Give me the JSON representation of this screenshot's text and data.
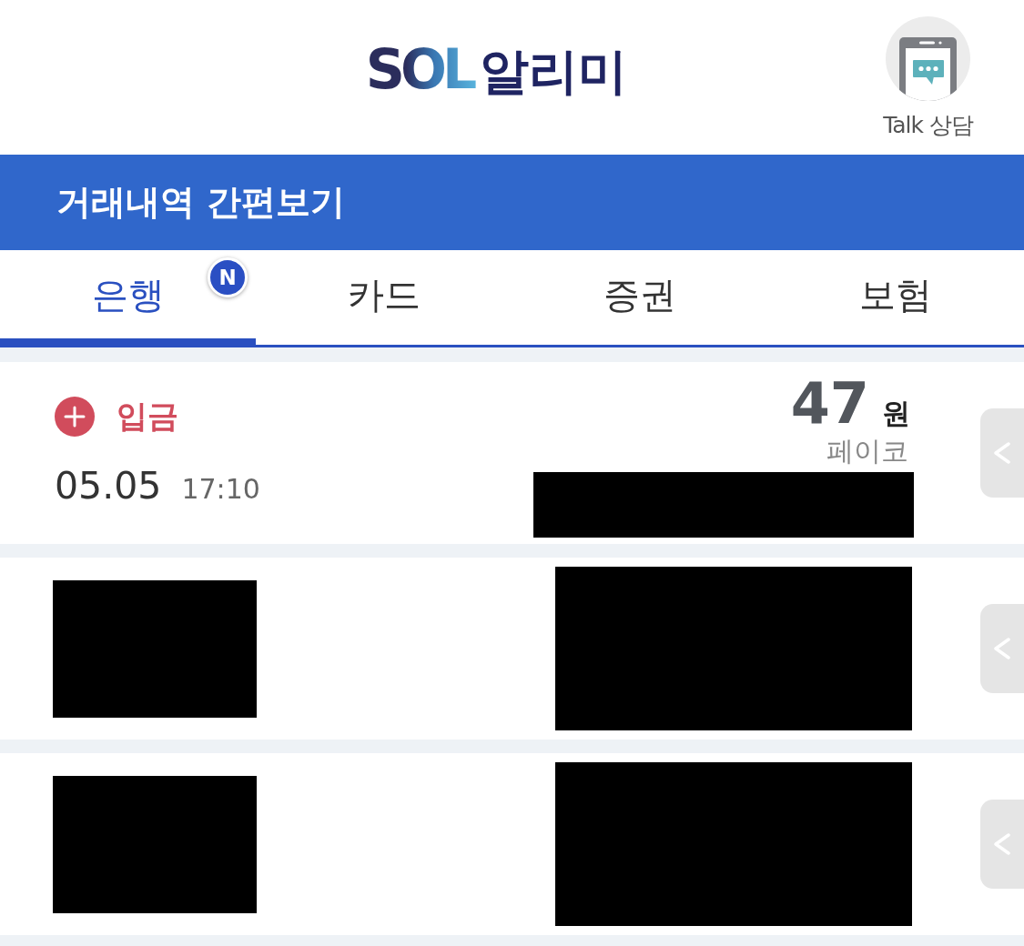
{
  "header": {
    "logo": {
      "brand": "SOL",
      "service": "알리미"
    },
    "talk_button": {
      "label": "Talk 상담"
    }
  },
  "banner": {
    "title": "거래내역 간편보기"
  },
  "tabs": [
    {
      "label": "은행",
      "selected": true,
      "badge": "N"
    },
    {
      "label": "카드",
      "selected": false
    },
    {
      "label": "증권",
      "selected": false
    },
    {
      "label": "보험",
      "selected": false
    }
  ],
  "transactions": [
    {
      "kind": "detail",
      "type": "입금",
      "color": "#d14c5c",
      "amount": "47",
      "unit": "원",
      "merchant": "페이코",
      "date": "05.05",
      "time": "17:10",
      "redacted": true
    },
    {
      "kind": "redacted"
    },
    {
      "kind": "redacted"
    }
  ]
}
